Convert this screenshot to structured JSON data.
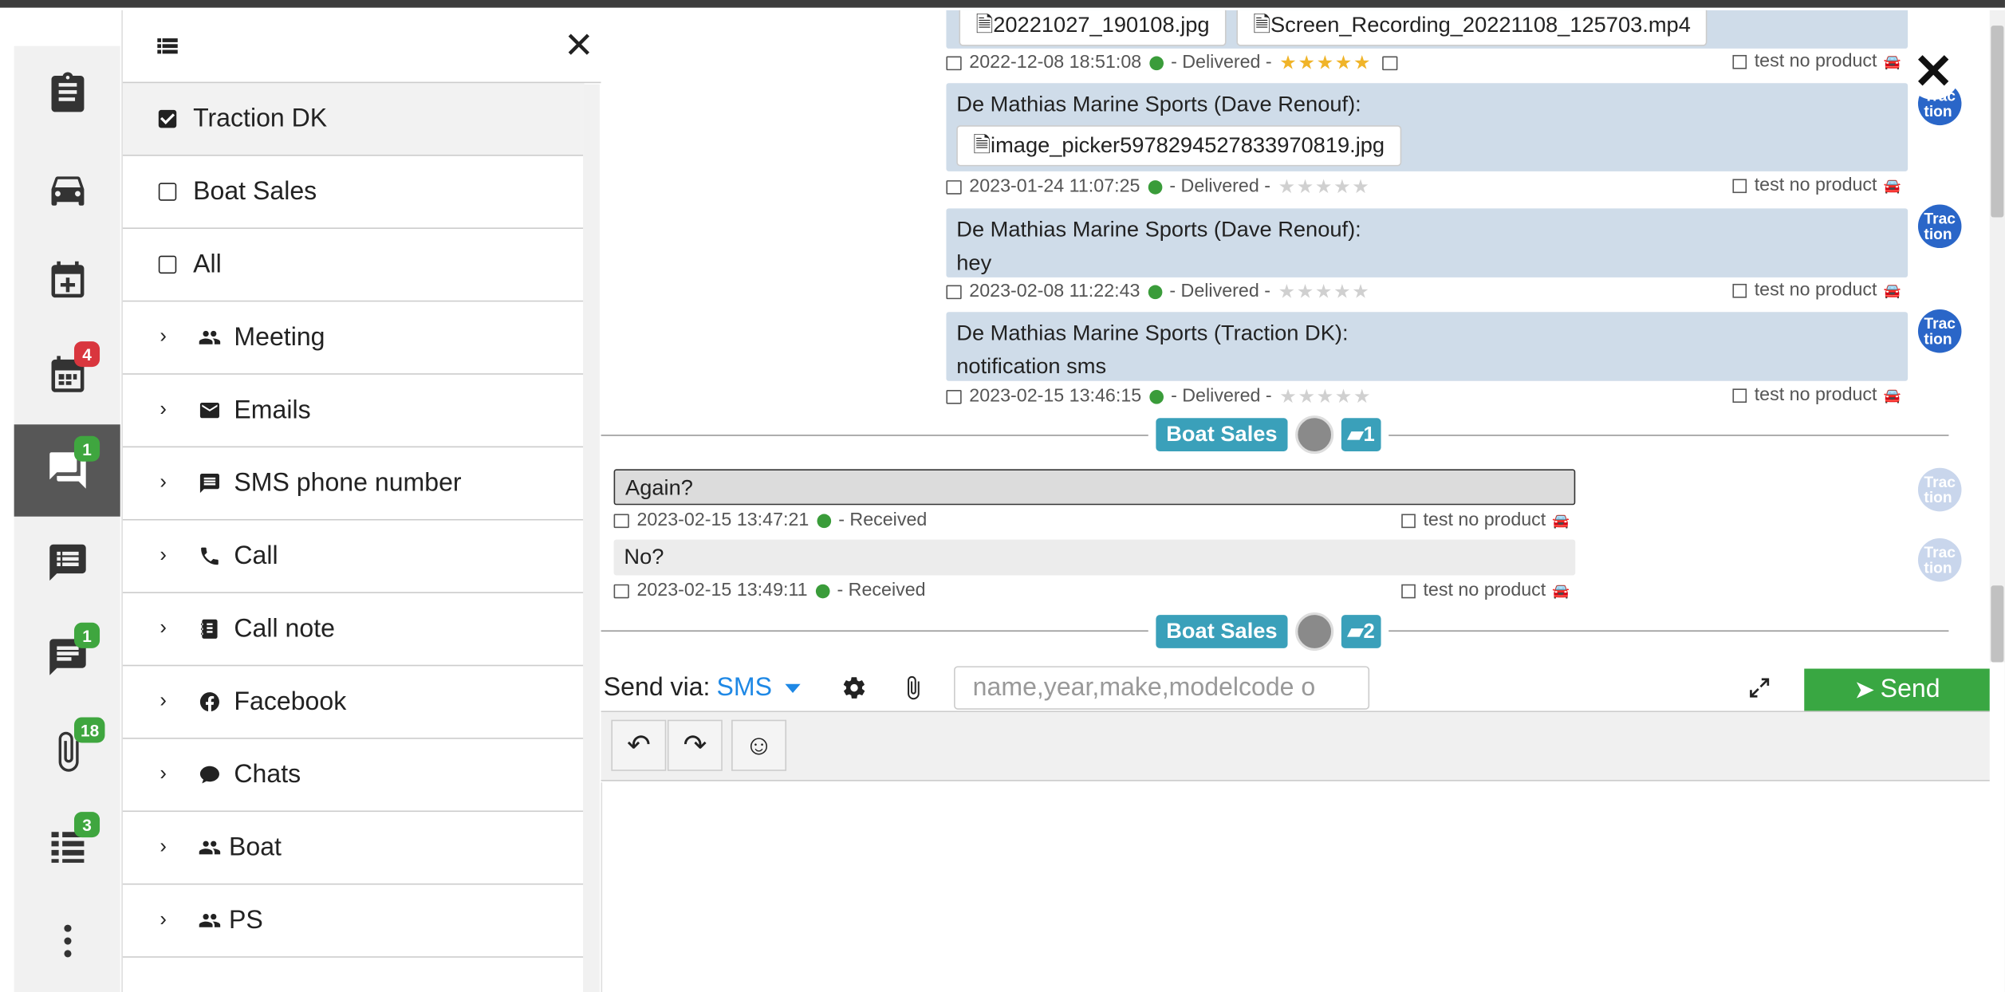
{
  "sidebar": {
    "items": [
      {
        "name": "clipboard-icon",
        "badge": ""
      },
      {
        "name": "car-icon",
        "badge": ""
      },
      {
        "name": "calendar-plus-icon",
        "badge": ""
      },
      {
        "name": "calendar-icon",
        "badge": "4",
        "badge_color": "#d9363e"
      },
      {
        "name": "chat-icon",
        "badge": "1",
        "badge_color": "#3fa63f",
        "active": true
      },
      {
        "name": "list-chat-icon",
        "badge": ""
      },
      {
        "name": "notes-icon",
        "badge": "1",
        "badge_color": "#3fa63f"
      },
      {
        "name": "paperclip-icon",
        "badge": "18",
        "badge_color": "#3fa63f"
      },
      {
        "name": "table-list-icon",
        "badge": "3",
        "badge_color": "#3fa63f"
      },
      {
        "name": "more-vertical-icon",
        "badge": ""
      }
    ]
  },
  "menu": {
    "close": "✕",
    "checks": [
      {
        "label": "Traction DK",
        "checked": true
      },
      {
        "label": "Boat Sales",
        "checked": false
      },
      {
        "label": "All",
        "checked": false
      }
    ],
    "groups": [
      {
        "label": "Meeting",
        "icon": "people-icon"
      },
      {
        "label": "Emails",
        "icon": "envelope-icon"
      },
      {
        "label": "SMS phone number",
        "icon": "sms-icon"
      },
      {
        "label": "Call",
        "icon": "phone-icon"
      },
      {
        "label": "Call note",
        "icon": "notebook-icon"
      },
      {
        "label": "Facebook",
        "icon": "facebook-icon"
      },
      {
        "label": "Chats",
        "icon": "speech-bubble-icon"
      },
      {
        "label": "Boat",
        "icon": "people-icon"
      },
      {
        "label": "PS",
        "icon": "people-icon"
      }
    ]
  },
  "messages": {
    "m0": {
      "attachments": [
        "20221027_190108.jpg",
        "Screen_Recording_20221108_125703.mp4"
      ],
      "timestamp": "2022-12-08 18:51:08",
      "status": "- Delivered -",
      "stars": "★★★★★",
      "product": "test no product"
    },
    "m1": {
      "sender": "De Mathias Marine Sports (Dave Renouf):",
      "attachment": "image_picker5978294527833970819.jpg",
      "timestamp": "2023-01-24 11:07:25",
      "status": "- Delivered -",
      "stars": "★★★★★",
      "product": "test no product"
    },
    "m2": {
      "sender": "De Mathias Marine Sports (Dave Renouf):",
      "body": "hey",
      "timestamp": "2023-02-08 11:22:43",
      "status": "- Delivered -",
      "stars": "★★★★★",
      "product": "test no product"
    },
    "m3": {
      "sender": "De Mathias Marine Sports (Traction DK):",
      "body": "notification sms",
      "timestamp": "2023-02-15 13:46:15",
      "status": "- Delivered -",
      "stars": "★★★★★",
      "product": "test no product"
    },
    "sep1": {
      "tag": "Boat Sales",
      "count": "1"
    },
    "r1": {
      "body": "Again?",
      "timestamp": "2023-02-15 13:47:21",
      "status": "- Received",
      "product": "test no product"
    },
    "r2": {
      "body": "No?",
      "timestamp": "2023-02-15 13:49:11",
      "status": "- Received",
      "product": "test no product"
    },
    "sep2": {
      "tag": "Boat Sales",
      "count": "2"
    },
    "avatar_text": "Trac\ntion"
  },
  "composer": {
    "send_via_label": "Send via:",
    "channel": "SMS",
    "search_placeholder": "name,year,make,modelcode o",
    "send_label": "Send",
    "undo": "↶",
    "redo": "↷",
    "emoji": "☺"
  }
}
